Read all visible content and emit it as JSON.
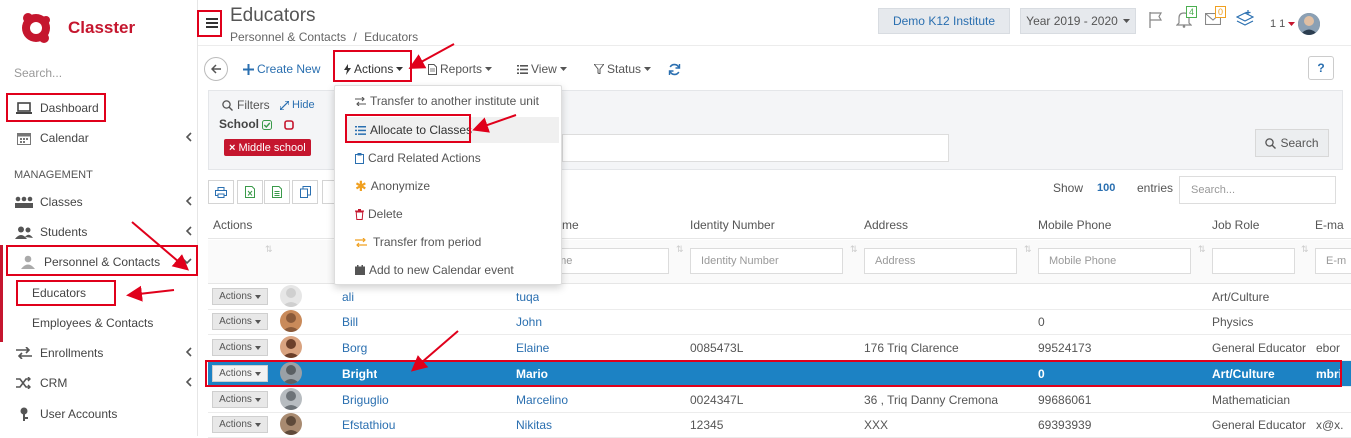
{
  "app": {
    "name": "Classter",
    "brand_color": "#c5162e",
    "accent_color": "#1c82c4"
  },
  "sidebar": {
    "search_placeholder": "Search...",
    "dashboard": "Dashboard",
    "calendar": "Calendar",
    "section": "MANAGEMENT",
    "classes": "Classes",
    "students": "Students",
    "personnel": "Personnel & Contacts",
    "educators": "Educators",
    "employees": "Employees & Contacts",
    "enrollments": "Enrollments",
    "crm": "CRM",
    "user_accounts": "User Accounts"
  },
  "header": {
    "title": "Educators",
    "breadcrumb_1": "Personnel & Contacts",
    "breadcrumb_sep": "/",
    "breadcrumb_2": "Educators",
    "institute": "Demo K12 Institute",
    "year": "Year 2019 - 2020",
    "notif_count": "4",
    "msg_count": "0",
    "user_num": "1 1"
  },
  "toolbar": {
    "create_new": "Create New",
    "actions": "Actions",
    "reports": "Reports",
    "view": "View",
    "status": "Status",
    "help": "?"
  },
  "filters": {
    "label": "Filters",
    "hide": "Hide",
    "school": "School",
    "chip": "Middle school",
    "search": "Search"
  },
  "table_controls": {
    "show": "Show",
    "show_value": "100",
    "entries": "entries",
    "search_placeholder": "Search..."
  },
  "dropdown": {
    "items": [
      "Transfer to another institute unit",
      "Allocate to Classes",
      "Card Related Actions",
      "Anonymize",
      "Delete",
      "Transfer from period",
      "Add to new Calendar event"
    ]
  },
  "table": {
    "headers": [
      "Actions",
      "me",
      "Identity Number",
      "Address",
      "Mobile Phone",
      "Job Role",
      "E-ma"
    ],
    "filter_placeholders": [
      "ame",
      "Identity Number",
      "Address",
      "Mobile Phone",
      "E-m"
    ],
    "action_label": "Actions",
    "rows": [
      {
        "last": "ali",
        "first": "tuqa",
        "id": "",
        "address": "",
        "mobile": "",
        "role": "Art/Culture",
        "email": ""
      },
      {
        "last": "Bill",
        "first": "John",
        "id": "",
        "address": "",
        "mobile": "0",
        "role": "Physics",
        "email": ""
      },
      {
        "last": "Borg",
        "first": "Elaine",
        "id": "0085473L",
        "address": "176 Triq Clarence",
        "mobile": "99524173",
        "role": "General Educator",
        "email": "ebor"
      },
      {
        "last": "Bright",
        "first": "Mario",
        "id": "",
        "address": "",
        "mobile": "0",
        "role": "Art/Culture",
        "email": "mbri"
      },
      {
        "last": "Briguglio",
        "first": "Marcelino",
        "id": "0024347L",
        "address": "36 , Triq Danny Cremona",
        "mobile": "99686061",
        "role": "Mathematician",
        "email": ""
      },
      {
        "last": "Efstathiou",
        "first": "Nikitas",
        "id": "12345",
        "address": "XXX",
        "mobile": "69393939",
        "role": "General Educator",
        "email": "x@x."
      }
    ]
  }
}
